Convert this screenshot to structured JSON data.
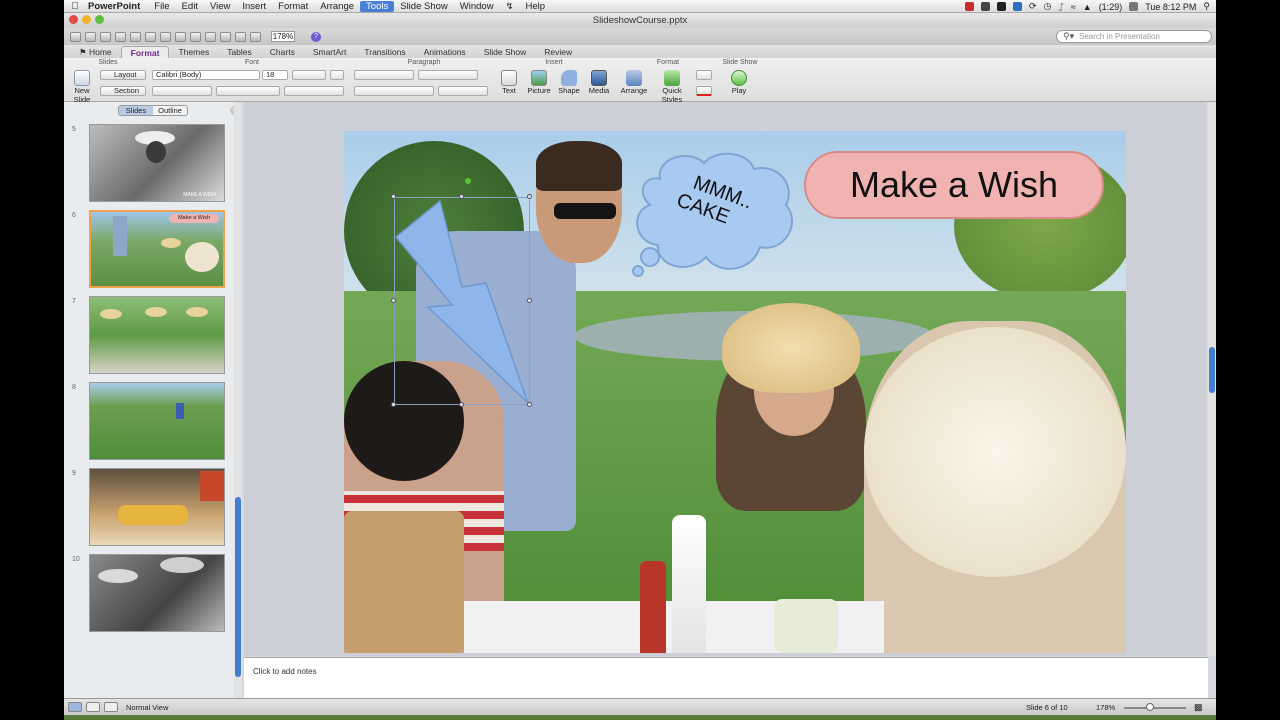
{
  "menubar": {
    "app_name": "PowerPoint",
    "items": [
      "File",
      "Edit",
      "View",
      "Insert",
      "Format",
      "Arrange",
      "Tools",
      "Slide Show",
      "Window",
      "Help"
    ],
    "active_item": "Tools",
    "battery": "(1:29)",
    "clock": "Tue 8:12 PM"
  },
  "window": {
    "title": "SlideshowCourse.pptx"
  },
  "toolbar": {
    "zoom": "178%",
    "search_placeholder": "Search in Presentation"
  },
  "ribbon_tabs": [
    "Home",
    "Format",
    "Themes",
    "Tables",
    "Charts",
    "SmartArt",
    "Transitions",
    "Animations",
    "Slide Show",
    "Review"
  ],
  "ribbon_active_tab": "Format",
  "ribbon": {
    "groups": {
      "slides": "Slides",
      "font": "Font",
      "paragraph": "Paragraph",
      "insert": "Insert",
      "format": "Format",
      "slideshow": "Slide Show"
    },
    "new_slide": "New Slide",
    "layout": "Layout",
    "section": "Section",
    "font_name": "Calibri (Body)",
    "font_size": "18",
    "text": "Text",
    "picture": "Picture",
    "shape": "Shape",
    "media": "Media",
    "arrange": "Arrange",
    "quick_styles": "Quick Styles",
    "play": "Play"
  },
  "pane_tabs": {
    "slides": "Slides",
    "outline": "Outline",
    "active": "Slides"
  },
  "thumbnails": [
    {
      "number": "5",
      "caption": "MAKE A WISH"
    },
    {
      "number": "6",
      "caption": "Make a Wish",
      "selected": true
    },
    {
      "number": "7",
      "caption": ""
    },
    {
      "number": "8",
      "caption": ""
    },
    {
      "number": "9",
      "caption": ""
    },
    {
      "number": "10",
      "caption": ""
    }
  ],
  "slide": {
    "title": "Make a Wish",
    "cloud_line1": "MMM..",
    "cloud_line2": "CAKE"
  },
  "notes_placeholder": "Click to add notes",
  "status": {
    "view": "Normal View",
    "slide_counter": "Slide 6 of 10",
    "zoom": "178%"
  },
  "colors": {
    "accent": "#3f7ed0",
    "title_box": "#f0b3b1",
    "cloud": "#a8c9f0",
    "bolt": "#8fb6ea",
    "thumb_selected": "#f0a24b"
  }
}
